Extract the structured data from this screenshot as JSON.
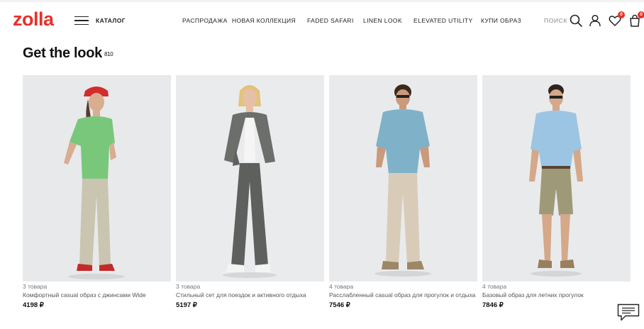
{
  "brand": {
    "logo_text": "zolla",
    "brand_color": "#e4322b"
  },
  "header": {
    "catalog_label": "КАТАЛОГ",
    "nav": [
      "РАСПРОДАЖА",
      "НОВАЯ КОЛЛЕКЦИЯ",
      "FADED SAFARI",
      "LINEN LOOK",
      "ELEVATED UTILITY",
      "КУПИ ОБРАЗ"
    ],
    "search_label": "ПОИСК",
    "favorites_count": "0",
    "cart_count": "0",
    "icons": [
      "menu-icon",
      "search-icon",
      "user-icon",
      "heart-icon",
      "bag-icon"
    ]
  },
  "page": {
    "title": "Get the look",
    "count": "810"
  },
  "looks": [
    {
      "count": "3 товара",
      "name": "Комфортный casual образ с джинсами Wide",
      "price": "4198 ₽"
    },
    {
      "count": "3 товара",
      "name": "Стильный сет для поездок и активного отдыха",
      "price": "5197 ₽"
    },
    {
      "count": "4 товара",
      "name": "Расслабленный casual образ для прогулок и отдыха",
      "price": "7546 ₽"
    },
    {
      "count": "4 товара",
      "name": "Базовый образ для летних прогулок",
      "price": "7846 ₽"
    }
  ],
  "chat": {
    "icon": "chat-icon"
  }
}
